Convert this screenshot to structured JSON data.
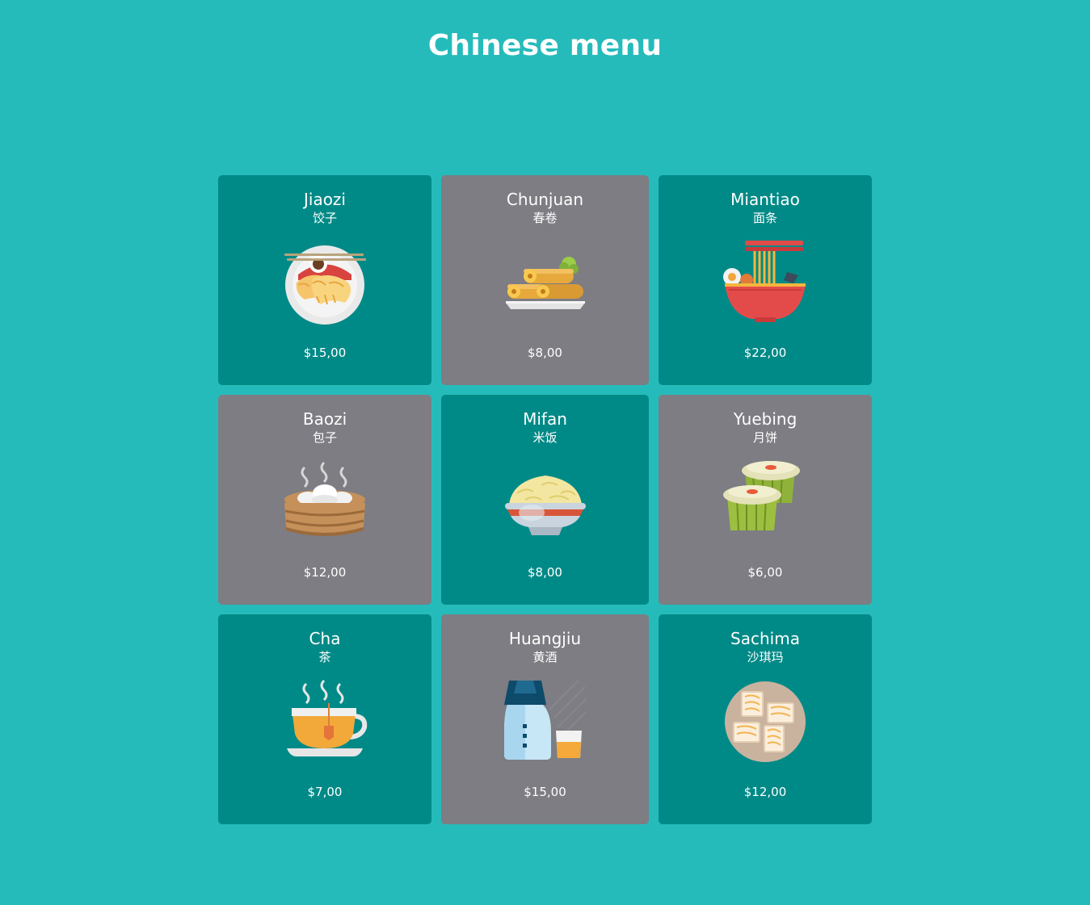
{
  "page": {
    "title": "Chinese menu"
  },
  "colors": {
    "background": "#26bbbb",
    "card_teal": "#008a87",
    "card_gray": "#7d7d83",
    "text": "#ffffff"
  },
  "menu": {
    "items": [
      {
        "name": "Jiaozi",
        "chinese": "饺子",
        "price": "$15,00",
        "icon": "dumplings-plate-icon",
        "style": "teal"
      },
      {
        "name": "Chunjuan",
        "chinese": "春卷",
        "price": "$8,00",
        "icon": "spring-rolls-icon",
        "style": "gray"
      },
      {
        "name": "Miantiao",
        "chinese": "面条",
        "price": "$22,00",
        "icon": "noodle-bowl-icon",
        "style": "teal"
      },
      {
        "name": "Baozi",
        "chinese": "包子",
        "price": "$12,00",
        "icon": "steamed-buns-basket-icon",
        "style": "gray"
      },
      {
        "name": "Mifan",
        "chinese": "米饭",
        "price": "$8,00",
        "icon": "rice-bowl-icon",
        "style": "teal"
      },
      {
        "name": "Yuebing",
        "chinese": "月饼",
        "price": "$6,00",
        "icon": "mooncake-icon",
        "style": "gray"
      },
      {
        "name": "Cha",
        "chinese": "茶",
        "price": "$7,00",
        "icon": "tea-cup-icon",
        "style": "teal"
      },
      {
        "name": "Huangjiu",
        "chinese": "黄酒",
        "price": "$15,00",
        "icon": "rice-wine-bottle-icon",
        "style": "gray"
      },
      {
        "name": "Sachima",
        "chinese": "沙琪玛",
        "price": "$12,00",
        "icon": "sachima-plate-icon",
        "style": "teal"
      }
    ]
  }
}
